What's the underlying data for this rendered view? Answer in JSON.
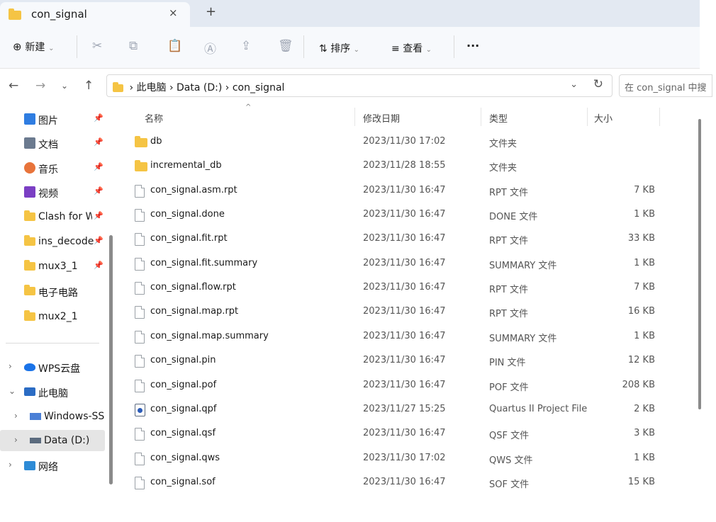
{
  "tab": {
    "title": "con_signal",
    "close": "×",
    "new_tab": "+"
  },
  "toolbar": {
    "new_label": "新建",
    "sort_label": "排序",
    "view_label": "查看",
    "more": "···"
  },
  "address": {
    "crumbs": [
      "此电脑",
      "Data (D:)",
      "con_signal"
    ],
    "search_placeholder": "在 con_signal 中搜"
  },
  "sidebar": {
    "pinned": [
      {
        "label": "图片",
        "icon": "pictures-icon"
      },
      {
        "label": "文档",
        "icon": "documents-icon"
      },
      {
        "label": "音乐",
        "icon": "music-icon"
      },
      {
        "label": "视频",
        "icon": "videos-icon"
      },
      {
        "label": "Clash for Wi",
        "icon": "folder-icon"
      },
      {
        "label": "ins_decode",
        "icon": "folder-icon"
      },
      {
        "label": "mux3_1",
        "icon": "folder-icon"
      },
      {
        "label": "电子电路",
        "icon": "folder-icon"
      },
      {
        "label": "mux2_1",
        "icon": "folder-icon"
      }
    ],
    "tree": [
      {
        "label": "WPS云盘",
        "chev": "›"
      },
      {
        "label": "此电脑",
        "chev": "⌄"
      },
      {
        "label": "Windows-SSD",
        "chev": "›"
      },
      {
        "label": "Data (D:)",
        "chev": "›"
      },
      {
        "label": "网络",
        "chev": "›"
      }
    ]
  },
  "columns": {
    "name": "名称",
    "date": "修改日期",
    "type": "类型",
    "size": "大小"
  },
  "files": [
    {
      "name": "db",
      "date": "2023/11/30 17:02",
      "type": "文件夹",
      "size": "",
      "kind": "folder"
    },
    {
      "name": "incremental_db",
      "date": "2023/11/28 18:55",
      "type": "文件夹",
      "size": "",
      "kind": "folder"
    },
    {
      "name": "con_signal.asm.rpt",
      "date": "2023/11/30 16:47",
      "type": "RPT 文件",
      "size": "7 KB",
      "kind": "file"
    },
    {
      "name": "con_signal.done",
      "date": "2023/11/30 16:47",
      "type": "DONE 文件",
      "size": "1 KB",
      "kind": "file"
    },
    {
      "name": "con_signal.fit.rpt",
      "date": "2023/11/30 16:47",
      "type": "RPT 文件",
      "size": "33 KB",
      "kind": "file"
    },
    {
      "name": "con_signal.fit.summary",
      "date": "2023/11/30 16:47",
      "type": "SUMMARY 文件",
      "size": "1 KB",
      "kind": "file"
    },
    {
      "name": "con_signal.flow.rpt",
      "date": "2023/11/30 16:47",
      "type": "RPT 文件",
      "size": "7 KB",
      "kind": "file"
    },
    {
      "name": "con_signal.map.rpt",
      "date": "2023/11/30 16:47",
      "type": "RPT 文件",
      "size": "16 KB",
      "kind": "file"
    },
    {
      "name": "con_signal.map.summary",
      "date": "2023/11/30 16:47",
      "type": "SUMMARY 文件",
      "size": "1 KB",
      "kind": "file"
    },
    {
      "name": "con_signal.pin",
      "date": "2023/11/30 16:47",
      "type": "PIN 文件",
      "size": "12 KB",
      "kind": "file"
    },
    {
      "name": "con_signal.pof",
      "date": "2023/11/30 16:47",
      "type": "POF 文件",
      "size": "208 KB",
      "kind": "file"
    },
    {
      "name": "con_signal.qpf",
      "date": "2023/11/27 15:25",
      "type": "Quartus II Project File",
      "size": "2 KB",
      "kind": "qpf"
    },
    {
      "name": "con_signal.qsf",
      "date": "2023/11/30 16:47",
      "type": "QSF 文件",
      "size": "3 KB",
      "kind": "file"
    },
    {
      "name": "con_signal.qws",
      "date": "2023/11/30 17:02",
      "type": "QWS 文件",
      "size": "1 KB",
      "kind": "file"
    },
    {
      "name": "con_signal.sof",
      "date": "2023/11/30 16:47",
      "type": "SOF 文件",
      "size": "15 KB",
      "kind": "file"
    }
  ]
}
